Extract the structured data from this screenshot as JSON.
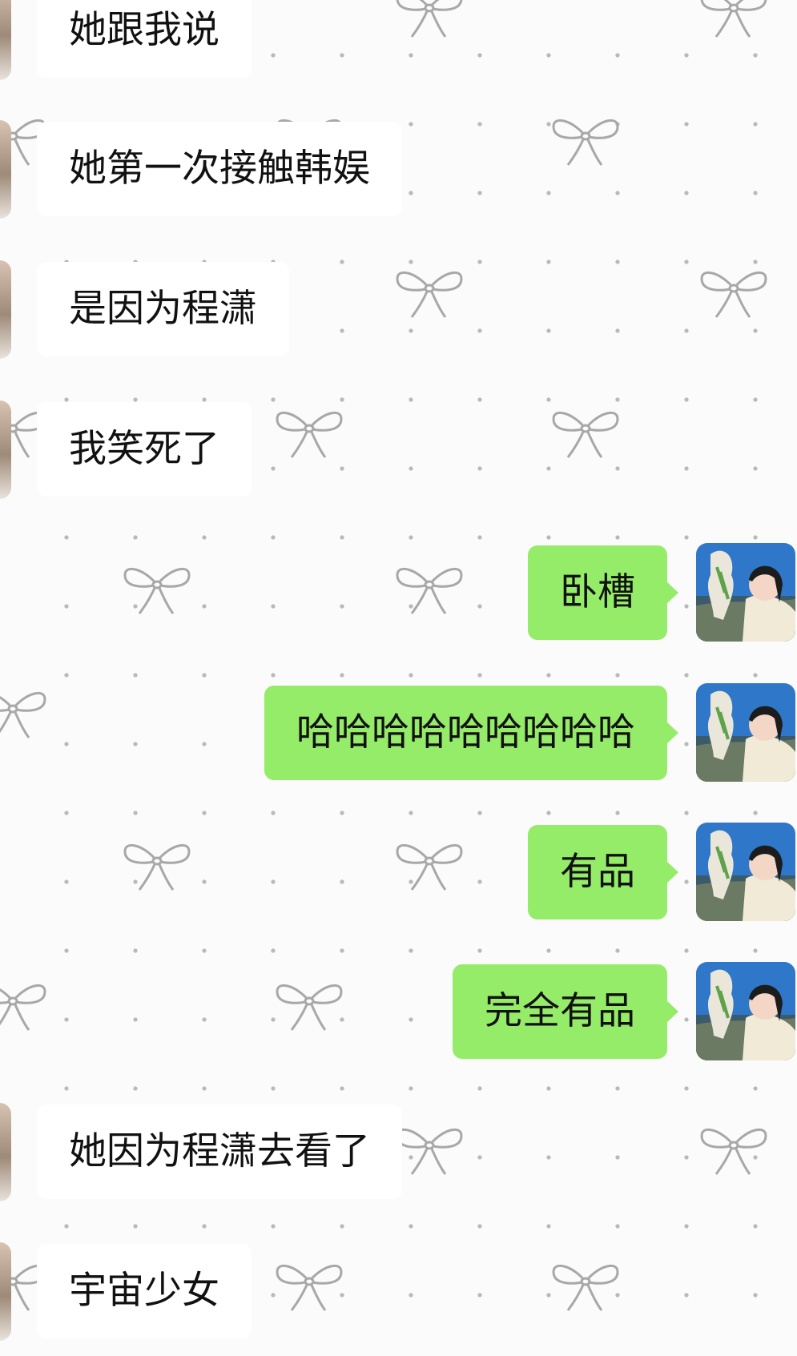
{
  "messages": [
    {
      "side": "in",
      "text": "她跟我说"
    },
    {
      "side": "in",
      "text": "她第一次接触韩娱"
    },
    {
      "side": "in",
      "text": "是因为程潇"
    },
    {
      "side": "in",
      "text": "我笑死了"
    },
    {
      "side": "out",
      "text": "卧槽"
    },
    {
      "side": "out",
      "text": "哈哈哈哈哈哈哈哈哈"
    },
    {
      "side": "out",
      "text": "有品"
    },
    {
      "side": "out",
      "text": "完全有品"
    },
    {
      "side": "in",
      "text": "她因为程潇去看了"
    },
    {
      "side": "in",
      "text": "宇宙少女"
    }
  ],
  "colors": {
    "outgoing_bubble": "#95ec69",
    "incoming_bubble": "#ffffff",
    "background": "#fbfbfb"
  },
  "icons": {
    "wallpaper": "ribbon-bow-icon",
    "peer_avatar": "avatar",
    "self_avatar": "avatar"
  }
}
